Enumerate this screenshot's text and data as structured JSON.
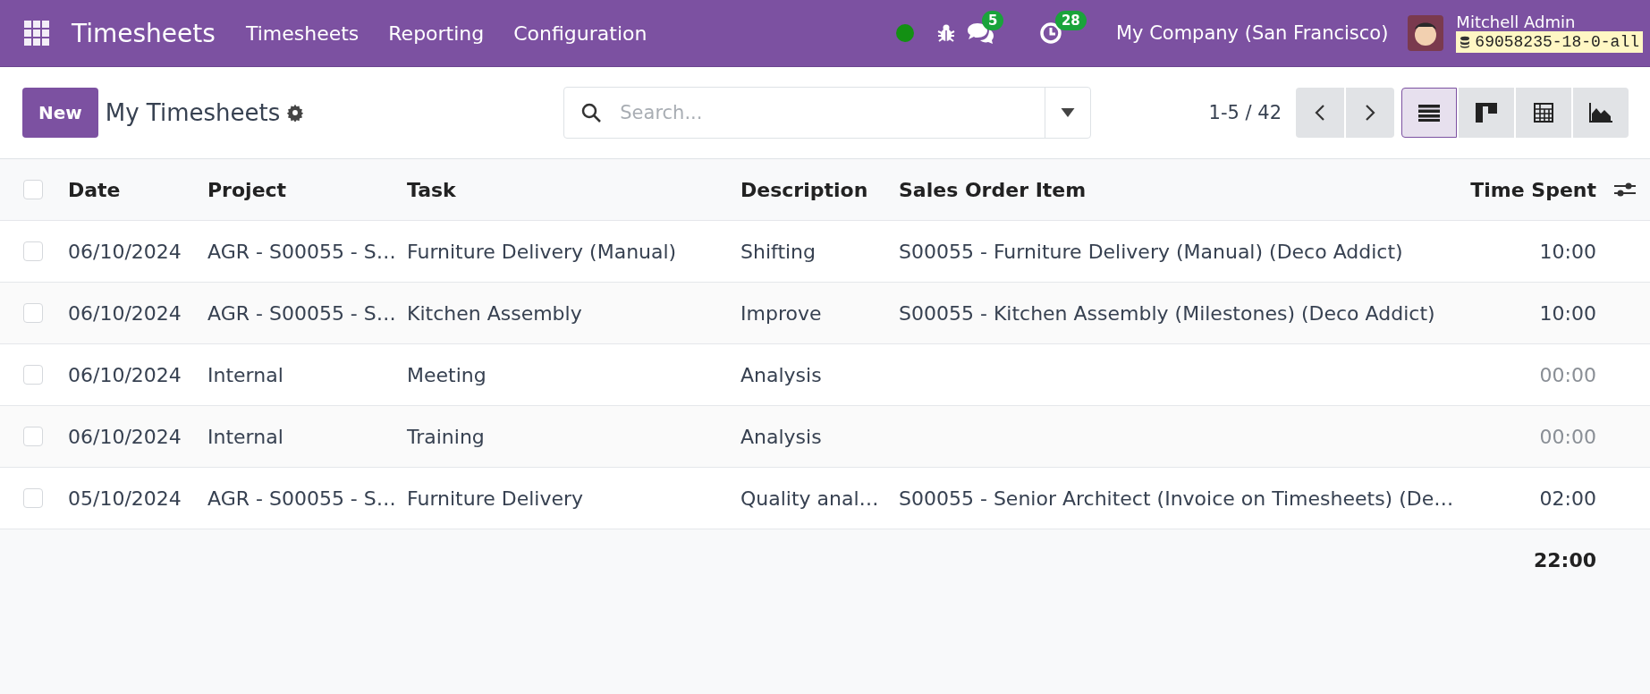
{
  "navbar": {
    "app_title": "Timesheets",
    "menu": [
      "Timesheets",
      "Reporting",
      "Configuration"
    ],
    "status_online": true,
    "messages_badge": "5",
    "activities_badge": "28",
    "company": "My Company (San Francisco)",
    "user": "Mitchell Admin",
    "database": "69058235-18-0-all"
  },
  "control_panel": {
    "new_button": "New",
    "title": "My Timesheets",
    "search": {
      "placeholder": "Search..."
    },
    "pager": "1-5 / 42",
    "views": [
      {
        "kind": "list",
        "selected": true
      },
      {
        "kind": "kanban",
        "selected": false
      },
      {
        "kind": "pivot",
        "selected": false
      },
      {
        "kind": "graph",
        "selected": false
      }
    ]
  },
  "table": {
    "all_selected": false,
    "columns": [
      "Date",
      "Project",
      "Task",
      "Description",
      "Sales Order Item",
      "Time Spent"
    ],
    "rows": [
      {
        "selected": false,
        "zero": false,
        "cells": [
          "06/10/2024",
          "AGR - S00055 - S…",
          "Furniture Delivery (Manual)",
          "Shifting",
          "S00055 - Furniture Delivery (Manual) (Deco Addict)",
          "10:00"
        ]
      },
      {
        "selected": false,
        "zero": false,
        "cells": [
          "06/10/2024",
          "AGR - S00055 - S…",
          "Kitchen Assembly",
          "Improve",
          "S00055 - Kitchen Assembly (Milestones) (Deco Addict)",
          "10:00"
        ]
      },
      {
        "selected": false,
        "zero": true,
        "cells": [
          "06/10/2024",
          "Internal",
          "Meeting",
          "Analysis",
          "",
          "00:00"
        ]
      },
      {
        "selected": false,
        "zero": true,
        "cells": [
          "06/10/2024",
          "Internal",
          "Training",
          "Analysis",
          "",
          "00:00"
        ]
      },
      {
        "selected": false,
        "zero": false,
        "cells": [
          "05/10/2024",
          "AGR - S00055 - S…",
          "Furniture Delivery",
          "Quality anal…",
          "S00055 - Senior Architect (Invoice on Timesheets) (De…",
          "02:00"
        ]
      }
    ],
    "total": "22:00"
  }
}
